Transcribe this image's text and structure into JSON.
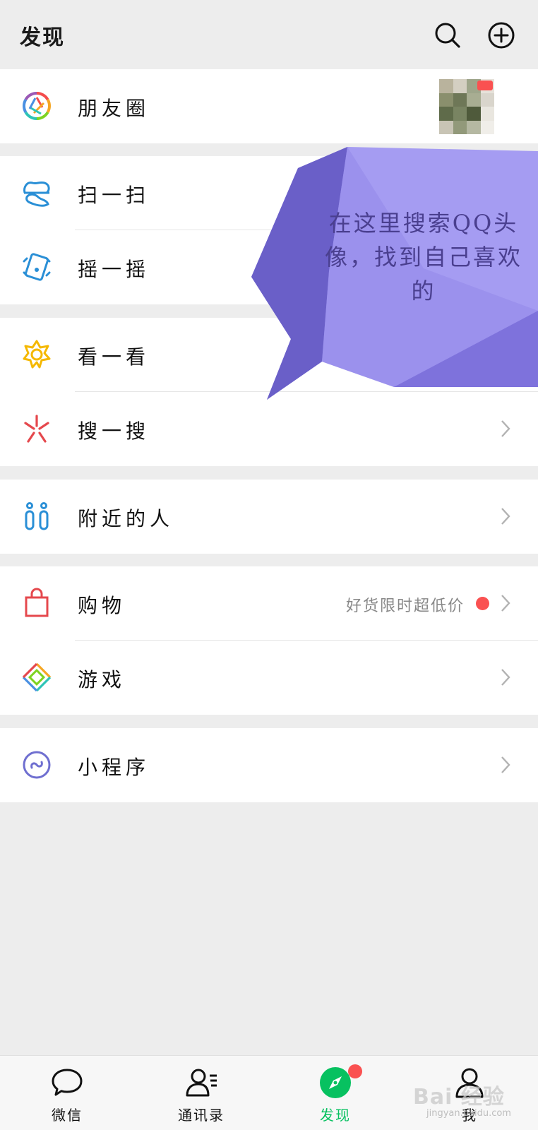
{
  "header": {
    "title": "发现",
    "search_icon": "search-icon",
    "add_icon": "plus-circle-icon"
  },
  "menu": {
    "moments": {
      "label": "朋友圈",
      "icon": "moments-aperture-icon"
    },
    "scan": {
      "label": "扫一扫",
      "icon": "scan-icon"
    },
    "shake": {
      "label": "摇一摇",
      "icon": "shake-icon"
    },
    "top_stories": {
      "label": "看一看",
      "icon": "top-stories-icon"
    },
    "search": {
      "label": "搜一搜",
      "icon": "search-star-icon"
    },
    "nearby": {
      "label": "附近的人",
      "icon": "people-nearby-icon"
    },
    "shopping": {
      "label": "购物",
      "icon": "shopping-bag-icon",
      "hint": "好货限时超低价"
    },
    "games": {
      "label": "游戏",
      "icon": "games-diamond-icon"
    },
    "mini_programs": {
      "label": "小程序",
      "icon": "mini-program-icon"
    }
  },
  "annotation": {
    "text": "在这里搜索QQ头像，找到自己喜欢的"
  },
  "tabbar": {
    "tabs": [
      {
        "label": "微信",
        "icon": "chat-bubble-icon"
      },
      {
        "label": "通讯录",
        "icon": "contacts-icon"
      },
      {
        "label": "发现",
        "icon": "compass-icon",
        "active": true
      },
      {
        "label": "我",
        "icon": "person-icon"
      }
    ]
  },
  "watermark": {
    "text": "Bai 经验",
    "sub": "jingyan.baidu.com"
  },
  "colors": {
    "accent_green": "#07c160",
    "badge_red": "#fa5151",
    "callout_purple": "#9b8ff0",
    "background": "#ededed"
  }
}
